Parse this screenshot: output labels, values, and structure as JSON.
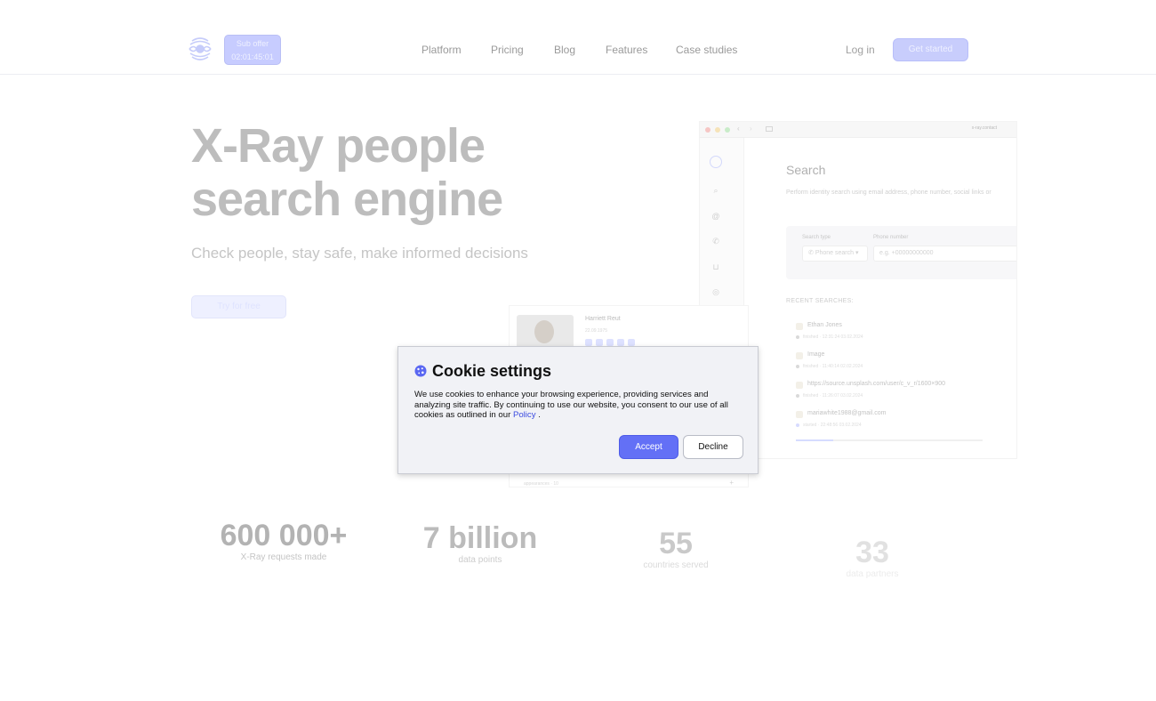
{
  "header": {
    "sub_offer": {
      "label": "Sub offer",
      "timer": "02:01:45:01"
    },
    "nav": [
      "Platform",
      "Pricing",
      "Blog",
      "Features",
      "Case studies"
    ],
    "login": "Log in",
    "get_started": "Get started"
  },
  "hero": {
    "title_line1": "X-Ray people",
    "title_line2": "search engine",
    "subtitle": "Check people, stay safe, make informed decisions",
    "cta": "Try for free"
  },
  "mockup": {
    "url": "x-ray.contact",
    "title": "Search",
    "description": "Perform identity search using email address, phone number, social links or",
    "search_type_label": "Search type",
    "search_type_value": "Phone search",
    "phone_label": "Phone number",
    "phone_placeholder": "e.g. +00000000000",
    "recent_heading": "RECENT SEARCHES:",
    "recent": [
      {
        "query": "Ethan Jones",
        "meta": "finished · 12:31:24 03.02.2024"
      },
      {
        "query": "Image",
        "meta": "finished · 11:40:14 02.02.2024"
      },
      {
        "query": "https://source.unsplash.com/user/c_v_r/1600×900",
        "meta": "finished · 11:26:07 03.02.2024"
      },
      {
        "query": "mariawhite1988@gmail.com",
        "meta": "started · 22:48:56 03.02.2024"
      }
    ],
    "progress": 0.2
  },
  "profile_card": {
    "name": "Harriett Reut",
    "date": "22.09.1975",
    "footer": "appearances · 10"
  },
  "stats": [
    {
      "value": "600 000+",
      "label": "X-Ray requests made"
    },
    {
      "value": "7 billion",
      "label": "data points"
    },
    {
      "value": "55",
      "label": "countries served"
    },
    {
      "value": "33",
      "label": "data partners"
    }
  ],
  "cookie": {
    "title": "Cookie settings",
    "body": "We use cookies to enhance your browsing experience, providing services and analyzing site traffic. By continuing to use our website, you consent to our use of all cookies as outlined in our",
    "link": "Policy",
    "body_end": ".",
    "accept": "Accept",
    "decline": "Decline"
  },
  "colors": {
    "accent": "#6370f6",
    "link": "#3b4be0"
  }
}
